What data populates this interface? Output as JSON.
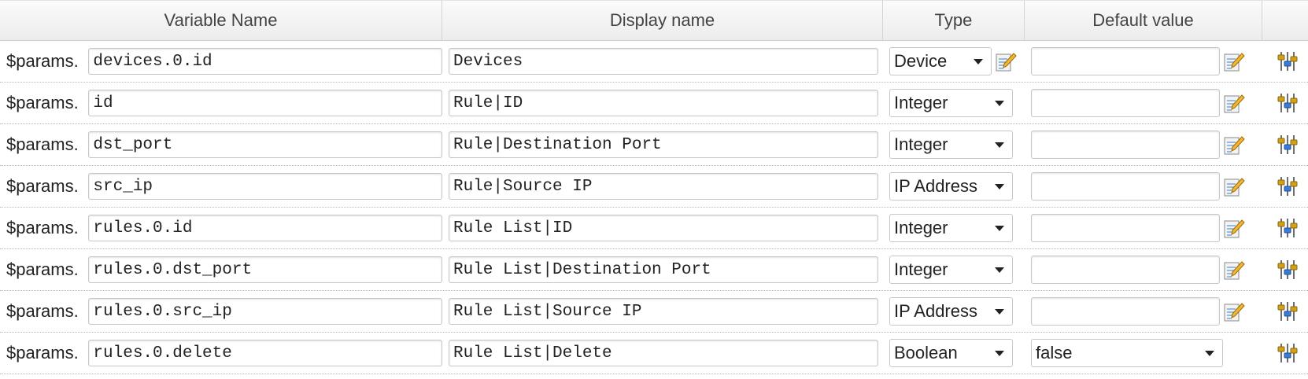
{
  "columns": {
    "variable_name": "Variable Name",
    "display_name": "Display name",
    "type": "Type",
    "default_value": "Default value"
  },
  "prefix": "$params.",
  "rows": [
    {
      "var": "devices.0.id",
      "display": "Devices",
      "type": "Device",
      "default": ""
    },
    {
      "var": "id",
      "display": "Rule|ID",
      "type": "Integer",
      "default": ""
    },
    {
      "var": "dst_port",
      "display": "Rule|Destination Port",
      "type": "Integer",
      "default": ""
    },
    {
      "var": "src_ip",
      "display": "Rule|Source IP",
      "type": "IP Address",
      "default": ""
    },
    {
      "var": "rules.0.id",
      "display": "Rule List|ID",
      "type": "Integer",
      "default": ""
    },
    {
      "var": "rules.0.dst_port",
      "display": "Rule List|Destination Port",
      "type": "Integer",
      "default": ""
    },
    {
      "var": "rules.0.src_ip",
      "display": "Rule List|Source IP",
      "type": "IP Address",
      "default": ""
    },
    {
      "var": "rules.0.delete",
      "display": "Rule List|Delete",
      "type": "Boolean",
      "default": "false"
    }
  ],
  "icons": {
    "edit": "edit-notepad-icon",
    "settings": "sliders-tools-icon",
    "dropdown": "chevron-down-icon"
  }
}
